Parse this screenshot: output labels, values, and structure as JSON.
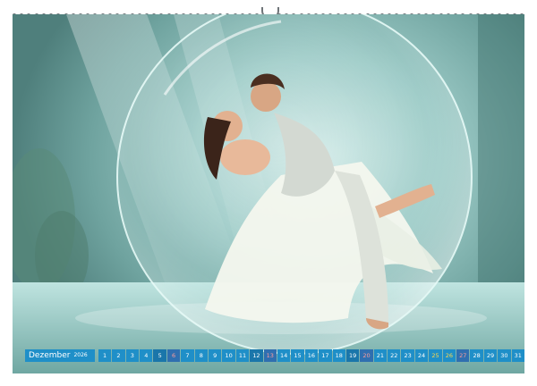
{
  "calendar": {
    "month": "Dezember",
    "year": "2026",
    "days": [
      {
        "n": "1",
        "t": "wd"
      },
      {
        "n": "2",
        "t": "wd"
      },
      {
        "n": "3",
        "t": "wd"
      },
      {
        "n": "4",
        "t": "wd"
      },
      {
        "n": "5",
        "t": "sat"
      },
      {
        "n": "6",
        "t": "sun"
      },
      {
        "n": "7",
        "t": "wd"
      },
      {
        "n": "8",
        "t": "wd"
      },
      {
        "n": "9",
        "t": "wd"
      },
      {
        "n": "10",
        "t": "wd"
      },
      {
        "n": "11",
        "t": "wd"
      },
      {
        "n": "12",
        "t": "sat"
      },
      {
        "n": "13",
        "t": "sun"
      },
      {
        "n": "14",
        "t": "wd"
      },
      {
        "n": "15",
        "t": "wd"
      },
      {
        "n": "16",
        "t": "wd"
      },
      {
        "n": "17",
        "t": "wd"
      },
      {
        "n": "18",
        "t": "wd"
      },
      {
        "n": "19",
        "t": "sat"
      },
      {
        "n": "20",
        "t": "sun"
      },
      {
        "n": "21",
        "t": "wd"
      },
      {
        "n": "22",
        "t": "wd"
      },
      {
        "n": "23",
        "t": "wd"
      },
      {
        "n": "24",
        "t": "wd"
      },
      {
        "n": "25",
        "t": "holiday"
      },
      {
        "n": "26",
        "t": "holiday"
      },
      {
        "n": "27",
        "t": "sun"
      },
      {
        "n": "28",
        "t": "wd"
      },
      {
        "n": "29",
        "t": "wd"
      },
      {
        "n": "30",
        "t": "wd"
      },
      {
        "n": "31",
        "t": "wd"
      }
    ]
  },
  "colors": {
    "strip_blue": "#1f8fc8",
    "weekend_blue": "#1a76aa",
    "sunday_text": "#ff9c9c",
    "holiday_text": "#ffd84a"
  },
  "image": {
    "subject": "couple-dancing-in-bubble-illustration"
  }
}
